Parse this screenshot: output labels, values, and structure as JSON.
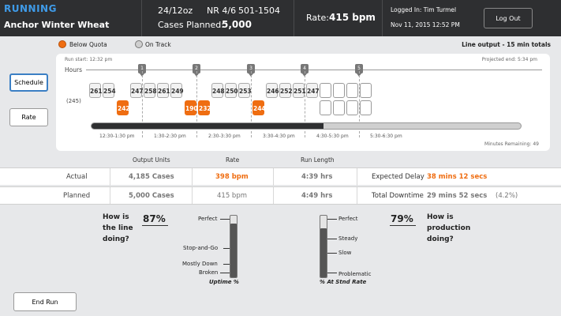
{
  "header": {
    "status": "RUNNING",
    "product": "Anchor Winter Wheat",
    "package": "24/12oz",
    "nr": "NR 4/6",
    "code": "501-1504",
    "cases_planned_label": "Cases Planned:",
    "cases_planned_value": "5,000",
    "rate_label": "Rate:",
    "rate_value": "415 bpm",
    "logged_in": "Logged In: Tim Turmel",
    "datetime": "Nov 11, 2015  12:52 PM",
    "logout_label": "Log Out"
  },
  "legend": {
    "below_quota": "Below Quota",
    "on_track": "On Track",
    "line_output": "Line output - 15 min totals",
    "below_color": "#ef6d11",
    "on_track_color": "#cfcfcf"
  },
  "side_buttons": {
    "schedule": "Schedule",
    "rate": "Rate"
  },
  "timeline": {
    "run_start": "Run start: 12:32 pm",
    "projected_end": "Projected end: 5:34 pm",
    "hours_label": "Hours",
    "baseline": "(245)",
    "markers": [
      "1",
      "2",
      "3",
      "4",
      "5"
    ],
    "top_values": [
      "261",
      "254",
      "247",
      "258",
      "261",
      "249",
      "248",
      "250",
      "253",
      "246",
      "252",
      "251",
      "247"
    ],
    "low_values": [
      "242",
      "190",
      "232",
      "244"
    ],
    "slot_labels": [
      "12:30-1:30 pm",
      "1:30-2:30 pm",
      "2:30-3:30 pm",
      "3:30-4:30 pm",
      "4:30-5:30 pm",
      "5:30-6:30 pm"
    ],
    "minutes_remaining": "Minutes Remaining: 49",
    "progress_fraction": 0.54
  },
  "stats": {
    "headers": [
      "Output Units",
      "Rate",
      "Run Length"
    ],
    "actual": {
      "label": "Actual",
      "units": "4,185 Cases",
      "rate": "398 bpm",
      "length": "4:39 hrs",
      "extra_label": "Expected Delay",
      "extra_value": "38 mins 12 secs"
    },
    "planned": {
      "label": "Planned",
      "units": "5,000 Cases",
      "rate": "415 bpm",
      "length": "4:49 hrs",
      "extra_label": "Total Downtime",
      "extra_value": "29 mins 52 secs",
      "extra_pct": "(4.2%)"
    }
  },
  "line_gauge": {
    "question": [
      "How is",
      "the line",
      "doing?"
    ],
    "percent": "87%",
    "value": 0.87,
    "labels": [
      "Perfect",
      "Stop-and-Go",
      "Mostly Down",
      "Broken"
    ],
    "title": "Uptime %"
  },
  "production_gauge": {
    "question": [
      "How is",
      "production",
      "doing?"
    ],
    "percent": "79%",
    "value": 0.79,
    "labels": [
      "Perfect",
      "Steady",
      "Slow",
      "Problematic"
    ],
    "title": "% At Stnd Rate"
  },
  "end_run_label": "End Run"
}
